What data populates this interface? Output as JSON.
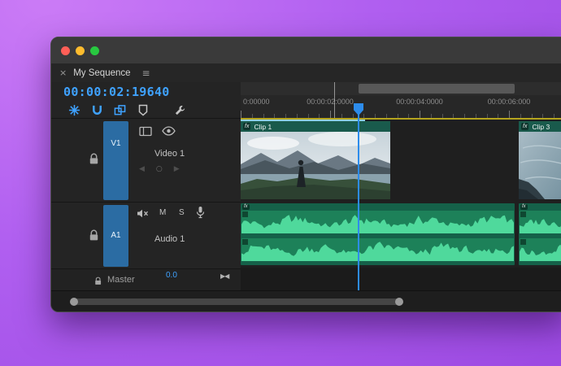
{
  "window": {
    "tab": {
      "close_glyph": "×",
      "title": "My Sequence",
      "menu_glyph": "≡"
    },
    "controls": [
      "close-button",
      "minimize-button",
      "zoom-button"
    ]
  },
  "timecode": "00:00:02:19640",
  "toolbar": {
    "icons": [
      "nest-insert",
      "snap-magnet",
      "linked-selection",
      "add-marker",
      "timeline-settings-wrench"
    ]
  },
  "ruler": {
    "labels": [
      "0:00000",
      "00:00:02:0000",
      "00:00:04:0000",
      "00:00:06:000"
    ]
  },
  "tracks": {
    "video1": {
      "target": "V1",
      "name": "Video 1",
      "kf_prev": "◀",
      "kf_toggle": "○",
      "kf_next": "▶"
    },
    "audio1": {
      "target": "A1",
      "name": "Audio 1",
      "mute": "M",
      "solo": "S"
    },
    "master": {
      "name": "Master",
      "gain": "0.0",
      "pan_glyph": "▶◀"
    }
  },
  "clips": {
    "video": [
      {
        "label": "Clip 1",
        "badge": "fx"
      },
      {
        "label": "",
        "badge": ""
      },
      {
        "label": "Clip 3",
        "badge": "fx"
      }
    ],
    "audio": [
      {
        "badge": "fx"
      },
      {
        "badge": "fx"
      }
    ]
  },
  "colors": {
    "accent_blue": "#3fa2ff",
    "playhead_blue": "#2d8ceb",
    "selection_blue": "#c9ebfc",
    "clip_header_teal": "#195a4c",
    "audio_green": "#1d8159",
    "waveform_green": "#4fd99c",
    "render_bar_yellow": "#b5a41e"
  }
}
